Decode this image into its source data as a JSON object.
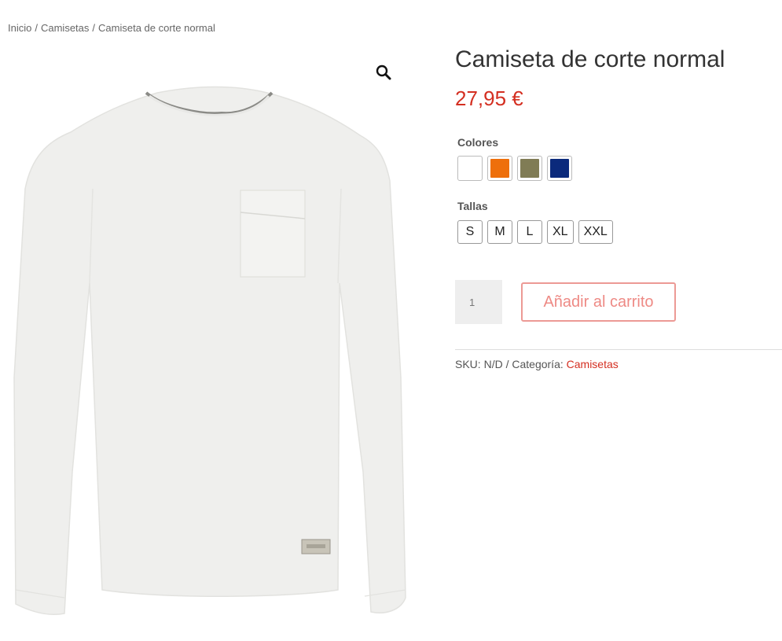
{
  "breadcrumb": {
    "items": [
      "Inicio",
      "Camisetas",
      "Camiseta de corte normal"
    ],
    "separator": "/"
  },
  "gallery": {
    "zoom_icon": "magnifier-icon",
    "image": "white-long-sleeve-shirt"
  },
  "product": {
    "title": "Camiseta de corte normal",
    "price": "27,95 €"
  },
  "attributes": {
    "colors_label": "Colores",
    "colors": [
      {
        "name": "white",
        "hex": "#ffffff"
      },
      {
        "name": "orange",
        "hex": "#ee6f0b"
      },
      {
        "name": "olive",
        "hex": "#807c55"
      },
      {
        "name": "navy",
        "hex": "#0b2a7c"
      }
    ],
    "sizes_label": "Tallas",
    "sizes": [
      "S",
      "M",
      "L",
      "XL",
      "XXL"
    ]
  },
  "cart": {
    "quantity": "1",
    "add_label": "Añadir al carrito"
  },
  "meta": {
    "sku_label": "SKU:",
    "sku_value": "N/D",
    "separator": "/",
    "category_label": "Categoría:",
    "category_value": "Camisetas"
  },
  "colors": {
    "accent": "#d42f21",
    "button_border": "#ec9a95"
  }
}
